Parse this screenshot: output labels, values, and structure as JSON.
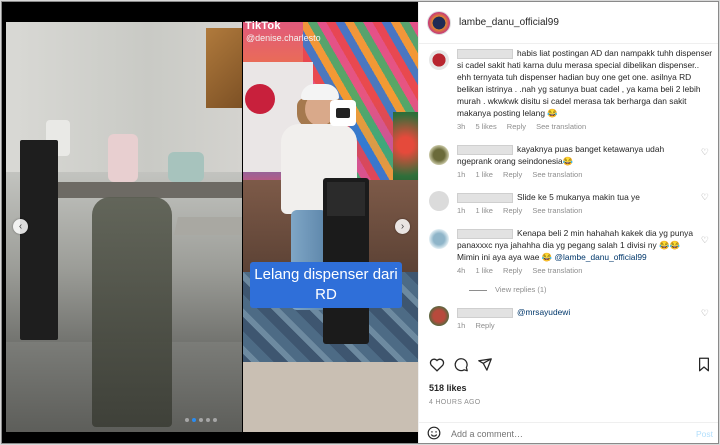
{
  "media": {
    "watermark": "TikTok",
    "watermark_user": "@denise.charlesto",
    "caption": "Lelang dispenser dari RD",
    "prev_glyph": "‹",
    "next_glyph": "›",
    "carousel_dots": 5,
    "active_dot": 1
  },
  "header": {
    "username": "lambe_danu_official99"
  },
  "comments": [
    {
      "text": "habis liat postingan AD dan nampakk tuhh dispenser si cadel sakit hati karna dulu merasa special dibelikan dispenser.. ehh ternyata tuh dispenser hadian buy one get one. asilnya RD belikan istrinya . .nah yg satunya buat cadel , ya kama beli 2 lebih murah . wkwkwk disitu si cadel merasa tak berharga dan sakit makanya posting lelang 😂",
      "time": "3h",
      "likes": "5 likes",
      "reply": "Reply",
      "translate": "See translation"
    },
    {
      "text": "kayaknya puas banget ketawanya udah ngeprank orang seindonesia😂",
      "time": "1h",
      "likes": "1 like",
      "reply": "Reply",
      "translate": "See translation"
    },
    {
      "text": "Slide ke 5 mukanya makin tua ye",
      "time": "1h",
      "likes": "1 like",
      "reply": "Reply",
      "translate": "See translation"
    },
    {
      "text": "Kenapa beli 2 min hahahah kakek dia yg punya panaxxxc nya jahahha dia yg pegang salah 1 divisi ny 😂😂 Mimin ini aya aya wae 😂",
      "mention": "@lambe_danu_official99",
      "time": "4h",
      "likes": "1 like",
      "reply": "Reply",
      "translate": "See translation",
      "view_replies": "View replies (1)"
    },
    {
      "mention": "@mrsayudewi",
      "time": "1h",
      "reply": "Reply"
    }
  ],
  "likes": "518 likes",
  "time_ago": "4 HOURS AGO",
  "add_comment": {
    "placeholder": "Add a comment…",
    "post_label": "Post"
  },
  "icons": [
    "heart-icon",
    "comment-icon",
    "share-icon",
    "bookmark-icon",
    "emoji-icon"
  ]
}
